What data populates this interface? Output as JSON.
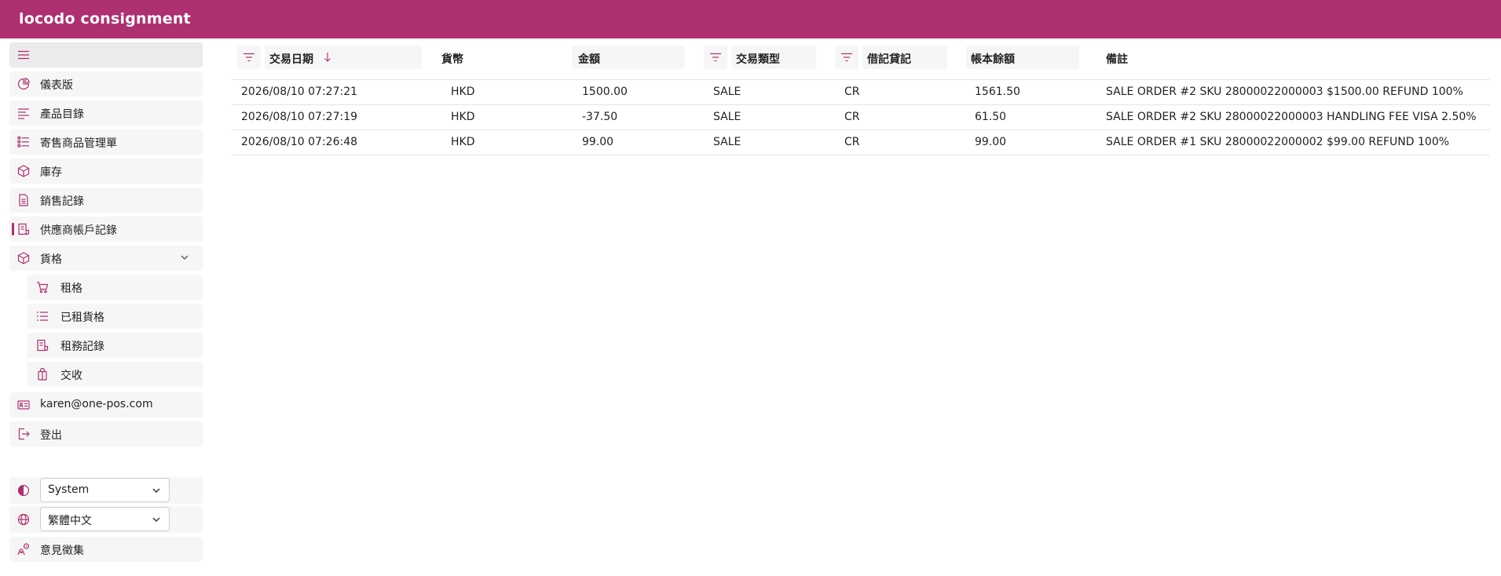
{
  "app": {
    "title": "locodo consignment"
  },
  "colors": {
    "brand": "#ae3070",
    "nav_bg": "#f6f6f6",
    "header_bg": "#f6f6f6"
  },
  "sidebar": {
    "menu_icon": "menu-icon",
    "items": [
      {
        "label": "儀表版",
        "icon": "dashboard-icon"
      },
      {
        "label": "產品目錄",
        "icon": "list-icon"
      },
      {
        "label": "寄售商品管理單",
        "icon": "checklist-icon"
      },
      {
        "label": "庫存",
        "icon": "box-icon"
      },
      {
        "label": "銷售記錄",
        "icon": "document-icon"
      },
      {
        "label": "供應商帳戶記錄",
        "icon": "ledger-icon",
        "active": true
      },
      {
        "label": "貨格",
        "icon": "box-icon",
        "expanded": true
      }
    ],
    "sub_items": [
      {
        "label": "租格",
        "icon": "cart-icon"
      },
      {
        "label": "已租貨格",
        "icon": "bullet-list-icon"
      },
      {
        "label": "租務記錄",
        "icon": "ledger-icon"
      },
      {
        "label": "交收",
        "icon": "bag-icon"
      }
    ],
    "account": {
      "email": "karen@one-pos.com",
      "icon": "id-card-icon"
    },
    "logout": {
      "label": "登出",
      "icon": "logout-icon"
    },
    "theme": {
      "value": "System",
      "icon": "contrast-icon"
    },
    "language": {
      "value": "繁體中文",
      "icon": "globe-icon"
    },
    "feedback": {
      "label": "意見徵集",
      "icon": "feedback-icon"
    }
  },
  "table": {
    "columns": {
      "date": "交易日期",
      "currency": "貨幣",
      "amount": "金額",
      "type": "交易類型",
      "drcr": "借記貸記",
      "balance": "帳本餘額",
      "remarks": "備註"
    },
    "sort": {
      "column": "交易日期",
      "direction": "descending"
    },
    "rows": [
      {
        "date": "2026/08/10 07:27:21",
        "currency": "HKD",
        "amount": "1500.00",
        "type": "SALE",
        "drcr": "CR",
        "balance": "1561.50",
        "remarks": "SALE ORDER #2 SKU 28000022000003 $1500.00 REFUND 100%"
      },
      {
        "date": "2026/08/10 07:27:19",
        "currency": "HKD",
        "amount": "-37.50",
        "type": "SALE",
        "drcr": "CR",
        "balance": "61.50",
        "remarks": "SALE ORDER #2 SKU 28000022000003 HANDLING FEE VISA 2.50%"
      },
      {
        "date": "2026/08/10 07:26:48",
        "currency": "HKD",
        "amount": "99.00",
        "type": "SALE",
        "drcr": "CR",
        "balance": "99.00",
        "remarks": "SALE ORDER #1 SKU 28000022000002 $99.00 REFUND 100%"
      }
    ]
  }
}
